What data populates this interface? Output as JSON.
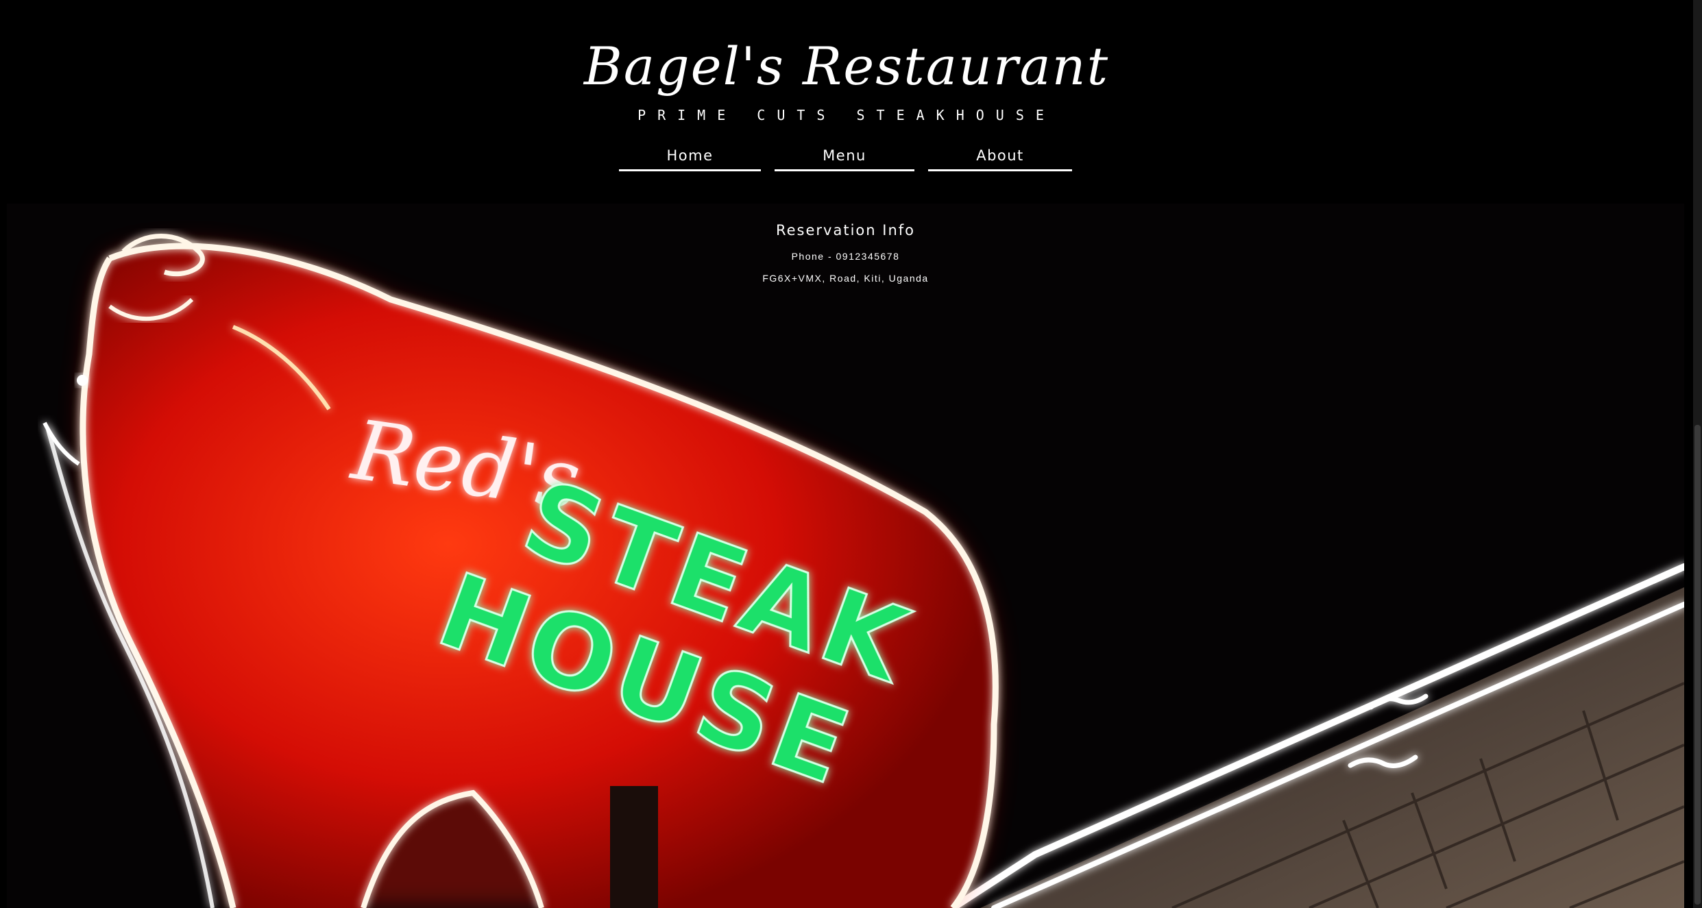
{
  "header": {
    "title": "Bagel's Restaurant",
    "tagline": "PRIME CUTS STEAKHOUSE"
  },
  "nav": {
    "items": [
      {
        "label": "Home"
      },
      {
        "label": "Menu"
      },
      {
        "label": "About"
      }
    ]
  },
  "reservation": {
    "title": "Reservation Info",
    "phone": "Phone - 0912345678",
    "address": "FG6X+VMX, Road, Kiti, Uganda"
  },
  "hero": {
    "sign_script": "Red's",
    "sign_line1": "STEAK",
    "sign_line2": "HOUSE",
    "colors": {
      "neon_red": "#ff1a0a",
      "neon_white": "#ffffff",
      "neon_green": "#1fe06a",
      "brick": "#5a4a3e"
    }
  }
}
